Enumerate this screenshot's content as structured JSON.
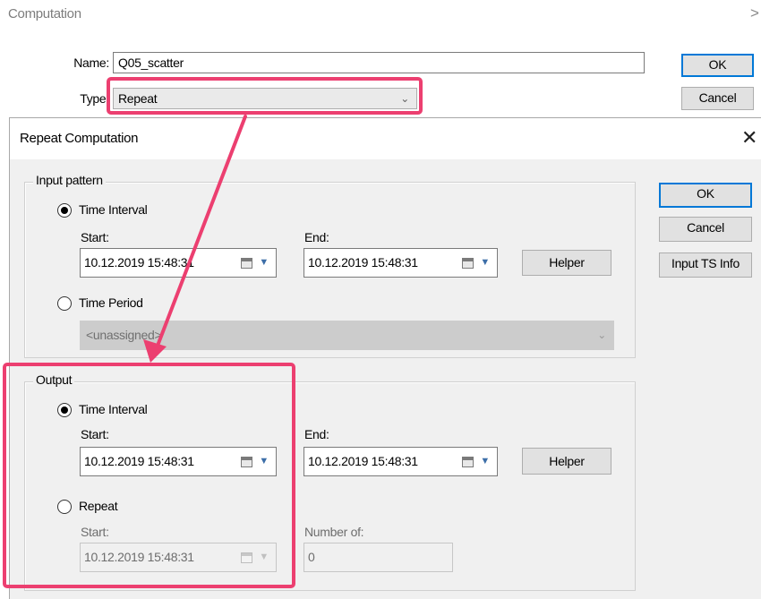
{
  "outer": {
    "title": "Computation",
    "close_glyph": ">",
    "name_label": "Name:",
    "name_value": "Q05_scatter",
    "type_label": "Type:",
    "type_value": "Repeat",
    "ok_label": "OK",
    "cancel_label": "Cancel"
  },
  "dialog": {
    "title": "Repeat Computation",
    "close_glyph": "✕",
    "ok_label": "OK",
    "cancel_label": "Cancel",
    "input_ts_label": "Input TS Info",
    "input_pattern": {
      "legend": "Input pattern",
      "time_interval_label": "Time Interval",
      "time_interval_selected": true,
      "start_label": "Start:",
      "start_value": "10.12.2019 15:48:31",
      "end_label": "End:",
      "end_value": "10.12.2019 15:48:31",
      "helper_label": "Helper",
      "time_period_label": "Time Period",
      "time_period_value": "<unassigned>"
    },
    "output": {
      "legend": "Output",
      "time_interval_label": "Time Interval",
      "time_interval_selected": true,
      "start_label": "Start:",
      "start_value": "10.12.2019 15:48:31",
      "end_label": "End:",
      "end_value": "10.12.2019 15:48:31",
      "helper_label": "Helper",
      "repeat_label": "Repeat",
      "repeat_start_label": "Start:",
      "repeat_start_value": "10.12.2019 15:48:31",
      "number_of_label": "Number of:",
      "number_of_value": "0"
    }
  },
  "colors": {
    "highlight": "#ec3f70",
    "dialog_bg": "#f0f0f0",
    "default_button_border": "#0078d7"
  },
  "icons": [
    "chevron-down-icon",
    "calendar-icon",
    "close-icon",
    "annotation-arrow"
  ]
}
